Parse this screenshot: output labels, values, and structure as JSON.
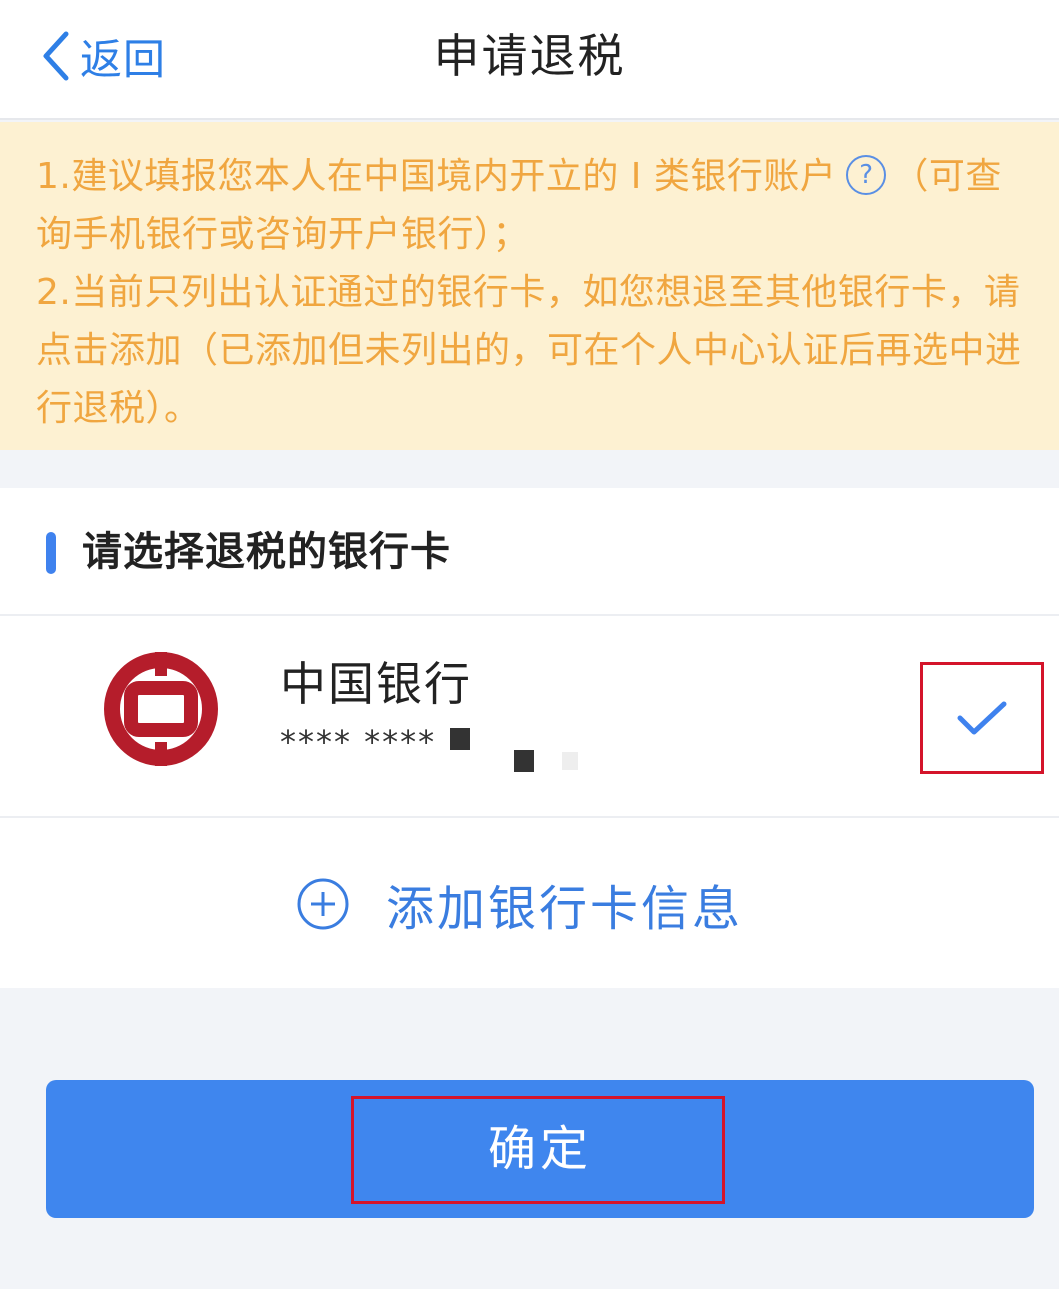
{
  "header": {
    "back_label": "返回",
    "title": "申请退税"
  },
  "notice": {
    "line1_part1": "1.建议填报您本人在中国境内开立的 I 类银行账户",
    "line1_part2": "（可查询手机银行或咨询开户银行）；",
    "line2": "2.当前只列出认证通过的银行卡，如您想退至其他银行卡，请点击添加（已添加但未列出的，可在个人中心认证后再选中进行退税）。",
    "help_icon_glyph": "?",
    "text_color": "#f0a640",
    "background_color": "#fdf1d2"
  },
  "card_section": {
    "title": "请选择退税的银行卡",
    "accent_color": "#3f82ee",
    "banks": [
      {
        "name": "中国银行",
        "number_masked": "**** ****",
        "logo_icon": "bank-of-china-logo",
        "logo_color": "#b51d2b",
        "selected": true
      }
    ],
    "add_card_label": "添加银行卡信息"
  },
  "confirm": {
    "label": "确定",
    "button_color": "#3f86ee"
  },
  "highlight_color": "#d4142a"
}
